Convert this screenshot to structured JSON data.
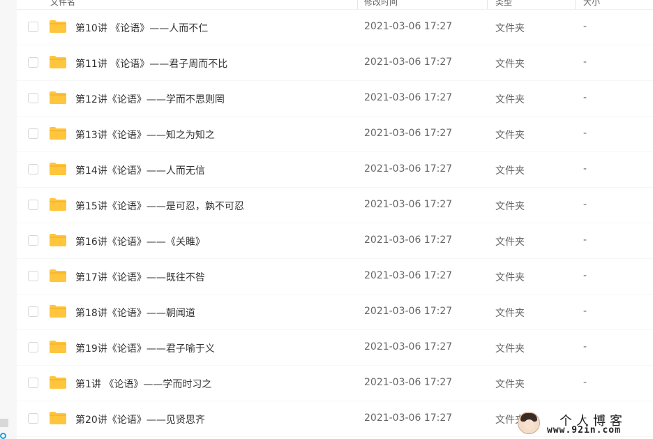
{
  "header": {
    "name_label": "文件名",
    "date_label": "修改时间",
    "type_label": "类型",
    "size_label": "大小"
  },
  "files": [
    {
      "name": "第10讲 《论语》——人而不仁",
      "date": "2021-03-06 17:27",
      "type": "文件夹",
      "size": "-"
    },
    {
      "name": "第11讲 《论语》——君子周而不比",
      "date": "2021-03-06 17:27",
      "type": "文件夹",
      "size": "-"
    },
    {
      "name": "第12讲《论语》——学而不思则罔",
      "date": "2021-03-06 17:27",
      "type": "文件夹",
      "size": "-"
    },
    {
      "name": "第13讲《论语》——知之为知之",
      "date": "2021-03-06 17:27",
      "type": "文件夹",
      "size": "-"
    },
    {
      "name": "第14讲《论语》——人而无信",
      "date": "2021-03-06 17:27",
      "type": "文件夹",
      "size": "-"
    },
    {
      "name": "第15讲《论语》——是可忍，孰不可忍",
      "date": "2021-03-06 17:27",
      "type": "文件夹",
      "size": "-"
    },
    {
      "name": "第16讲《论语》——《关雎》",
      "date": "2021-03-06 17:27",
      "type": "文件夹",
      "size": "-"
    },
    {
      "name": "第17讲《论语》——既往不咎",
      "date": "2021-03-06 17:27",
      "type": "文件夹",
      "size": "-"
    },
    {
      "name": "第18讲《论语》——朝闻道",
      "date": "2021-03-06 17:27",
      "type": "文件夹",
      "size": "-"
    },
    {
      "name": "第19讲《论语》——君子喻于义",
      "date": "2021-03-06 17:27",
      "type": "文件夹",
      "size": "-"
    },
    {
      "name": "第1讲 《论语》——学而时习之",
      "date": "2021-03-06 17:27",
      "type": "文件夹",
      "size": "-"
    },
    {
      "name": "第20讲《论语》——见贤思齐",
      "date": "2021-03-06 17:27",
      "type": "文件夹",
      "size": "-"
    }
  ],
  "watermark": {
    "title": "个人博客",
    "url": "www.92in.com"
  },
  "colors": {
    "folder": "#ffc53d",
    "folder_tab": "#f5b82e",
    "text": "#333333",
    "muted": "#666666"
  }
}
